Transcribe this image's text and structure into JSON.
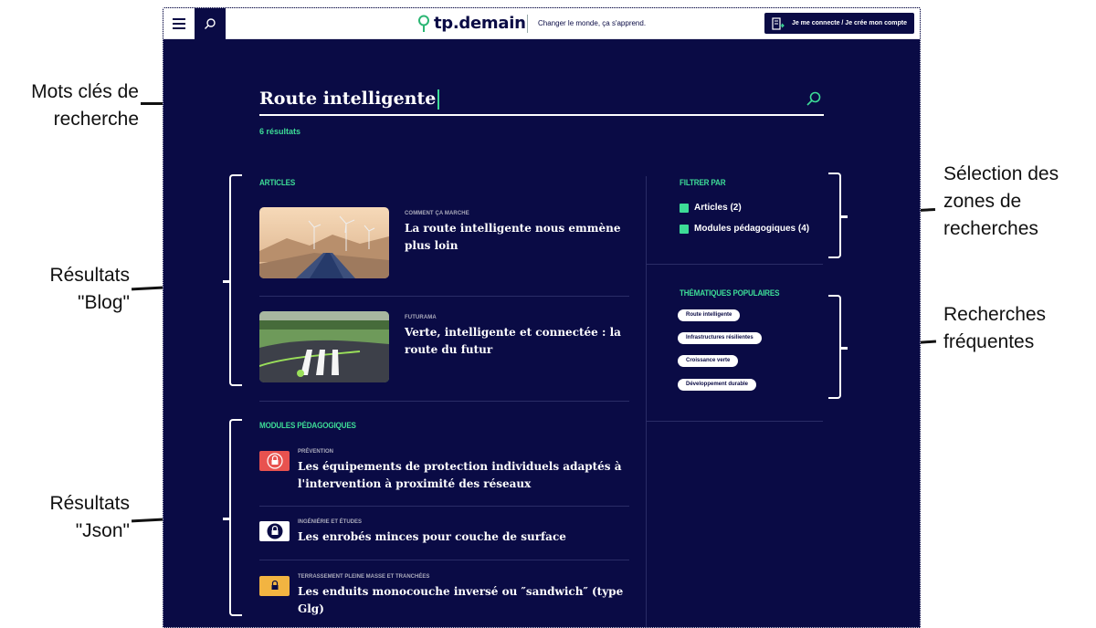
{
  "annotations": {
    "keywords": [
      "Mots clés de",
      "recherche"
    ],
    "blog": [
      "Résultats",
      "\"Blog\""
    ],
    "json": [
      "Résultats",
      "\"Json\""
    ],
    "zones": [
      "Sélection des",
      "zones de",
      "recherches"
    ],
    "frequent": [
      "Recherches",
      "fréquentes"
    ]
  },
  "header": {
    "logo": "tp.demain",
    "tagline": "Changer le monde, ça s'apprend.",
    "login": "Je me connecte / Je crée mon compte"
  },
  "search": {
    "value": "Route intelligente",
    "count": "6 résultats"
  },
  "articles": {
    "title": "ARTICLES",
    "items": [
      {
        "category": "COMMENT ÇA MARCHE",
        "title": "La route intelligente nous emmène plus loin"
      },
      {
        "category": "FUTURAMA",
        "title": "Verte, intelligente et connectée : la route du futur"
      }
    ]
  },
  "modules": {
    "title": "MODULES PÉDAGOGIQUES",
    "items": [
      {
        "category": "PRÉVENTION",
        "title": "Les équipements de protection individuels adaptés à l'intervention à proximité des réseaux",
        "icon": "lock-icon",
        "color": "#e8524f"
      },
      {
        "category": "INGÉNIÉRIE ET ÉTUDES",
        "title": "Les enrobés minces pour couche de surface",
        "icon": "lock-icon",
        "color": "#ffffff"
      },
      {
        "category": "TERRASSEMENT PLEINE MASSE ET TRANCHÉES",
        "title": "Les enduits monocouche inversé ou ″sandwich″ (type Glg)",
        "icon": "lock-icon",
        "color": "#f2b441"
      }
    ]
  },
  "filters": {
    "title": "FILTRER PAR",
    "items": [
      {
        "label": "Articles (2)"
      },
      {
        "label": "Modules pédagogiques (4)"
      }
    ]
  },
  "popular": {
    "title": "THÉMATIQUES POPULAIRES",
    "tags": [
      "Route intelligente",
      "Infrastructures résilientes",
      "Croissance verte",
      "Développement durable"
    ]
  },
  "colors": {
    "navy": "#0a0b45",
    "accent": "#3ddc97"
  }
}
